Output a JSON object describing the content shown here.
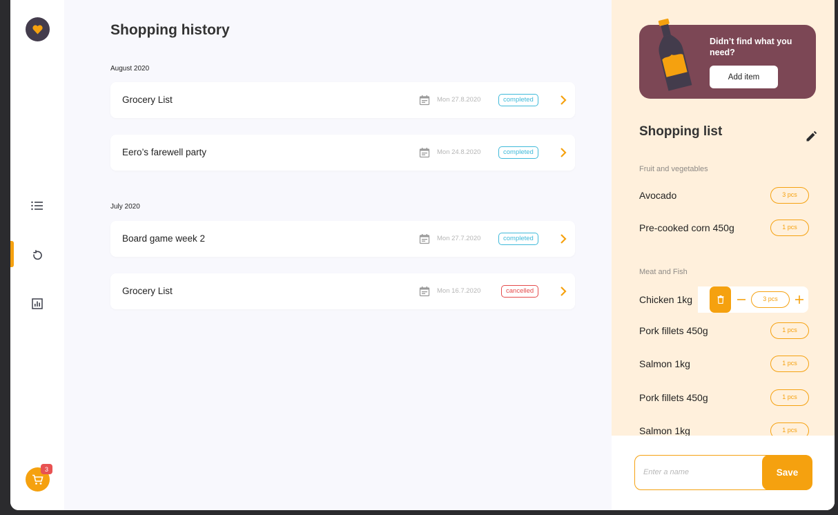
{
  "sidebar": {
    "logo_icon": "heart-logo-icon",
    "nav": [
      {
        "name": "list-icon",
        "active": false
      },
      {
        "name": "history-icon",
        "active": true
      },
      {
        "name": "stats-icon",
        "active": false
      }
    ],
    "cart_badge": "3"
  },
  "history": {
    "title": "Shopping history",
    "groups": [
      {
        "month": "August 2020",
        "entries": [
          {
            "name": "Grocery List",
            "date": "Mon 27.8.2020",
            "status": "completed"
          },
          {
            "name": "Eero’s farewell party",
            "date": "Mon 24.8.2020",
            "status": "completed"
          }
        ]
      },
      {
        "month": "July 2020",
        "entries": [
          {
            "name": "Board game week 2",
            "date": "Mon 27.7.2020",
            "status": "completed"
          },
          {
            "name": "Grocery List",
            "date": "Mon 16.7.2020",
            "status": "cancelled"
          }
        ]
      }
    ]
  },
  "panel": {
    "promo_text": "Didn’t find what you need?",
    "add_item_label": "Add item",
    "list_title": "Shopping list",
    "categories": [
      {
        "name": "Fruit and vegetables",
        "items": [
          {
            "name": "Avocado",
            "qty": "3 pcs"
          },
          {
            "name": "Pre-cooked corn 450g",
            "qty": "1 pcs"
          }
        ]
      },
      {
        "name": "Meat and Fish",
        "items": [
          {
            "name": "Chicken 1kg",
            "qty": "3 pcs"
          },
          {
            "name": "Pork fillets 450g",
            "qty": "1 pcs"
          },
          {
            "name": "Salmon 1kg",
            "qty": "1 pcs"
          },
          {
            "name": "Pork fillets 450g",
            "qty": "1 pcs"
          },
          {
            "name": "Salmon 1kg",
            "qty": "1 pcs"
          }
        ]
      }
    ],
    "name_placeholder": "Enter a name",
    "save_label": "Save"
  },
  "colors": {
    "accent": "#f5a10f",
    "promo": "#7c4755",
    "panel_bg": "#fff0dc",
    "completed": "#3eb9d9",
    "cancelled": "#e44a4a"
  }
}
